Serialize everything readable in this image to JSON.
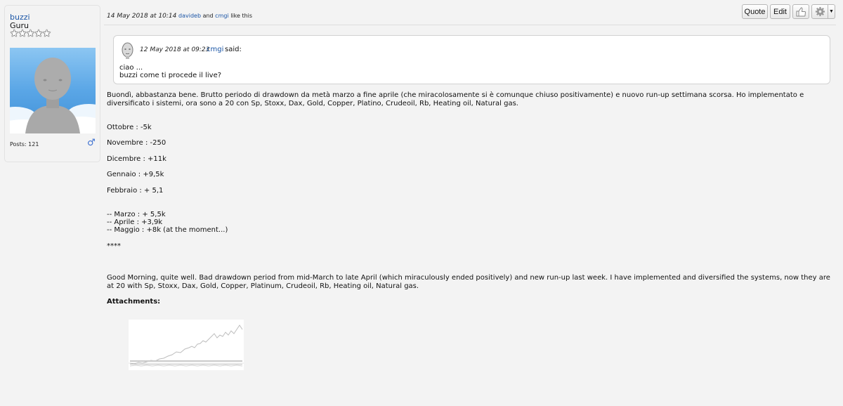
{
  "user": {
    "name": "buzzi",
    "rank": "Guru",
    "stars": [
      "★",
      "★",
      "★",
      "★",
      "★"
    ],
    "posts": "Posts: 121",
    "gender_icon": "♂"
  },
  "post": {
    "date": "14 May 2018 at 10:14",
    "liker1": "davideb",
    "and_text": "and",
    "liker2": "cmgi",
    "like_suffix": "like this"
  },
  "toolbar": {
    "quote_label": "Quote",
    "edit_label": "Edit",
    "thumb_icon": "thumbs-up-icon",
    "gear_icon": "gear-icon",
    "arrow_label": "▼"
  },
  "quote": {
    "meta": "12 May 2018 at 09:23",
    "user": "cmgi",
    "said": "said:",
    "line1": "ciao ...",
    "line2": "buzzi come ti procede il live?"
  },
  "body": {
    "intro": "Buondì, abbastanza bene. Brutto periodo di drawdown da metà marzo a fine aprile (che miracolosamente si è comunque chiuso positivamente) e nuovo run-up settimana scorsa. Ho implementato e diversificato i sistemi, ora sono a 20 con Sp, Stoxx, Dax, Gold, Copper, Platino, Crudeoil, Rb, Heating oil, Natural gas.",
    "months": [
      "Ottobre : -5k",
      "Novembre : -250",
      "Dicembre : +11k",
      "Gennaio : +9,5k",
      "Febbraio : + 5,1"
    ],
    "recent": [
      "-- Marzo : + 5,5k",
      "-- Aprile : +3,9k",
      "-- Maggio : +8k (at the moment...)"
    ],
    "separator": "****",
    "english": "Good Morning, quite well. Bad drawdown period from mid-March to late April (which miraculously ended positively) and new run-up last week. I have implemented and diversified the systems, now they are at 20 with Sp, Stoxx, Dax, Gold, Copper, Platinum, Crudeoil, Rb, Heating oil, Natural gas.",
    "attachments_label": "Attachments:"
  },
  "colors": {
    "link": "#1a55a6",
    "background": "#f3f3f3",
    "avatar_sky": "#5aa6e6",
    "avatar_figure": "#a9a9a9"
  }
}
